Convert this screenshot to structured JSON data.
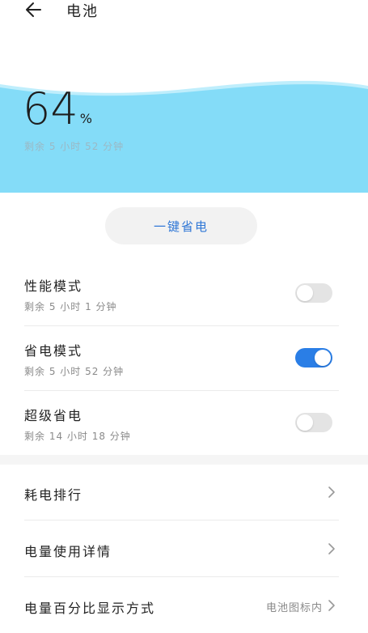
{
  "header": {
    "title": "电池"
  },
  "battery": {
    "percent": "64",
    "unit": "%",
    "remaining": "剩余 5 小时 52 分钟",
    "wave_color": "#84dcf8"
  },
  "one_key": {
    "label": "一键省电",
    "color": "#2f77d6"
  },
  "modes": [
    {
      "title": "性能模式",
      "subtitle": "剩余 5 小时 1 分钟",
      "enabled": false
    },
    {
      "title": "省电模式",
      "subtitle": "剩余 5 小时 52 分钟",
      "enabled": true
    },
    {
      "title": "超级省电",
      "subtitle": "剩余 14 小时 18 分钟",
      "enabled": false
    }
  ],
  "nav": [
    {
      "label": "耗电排行"
    },
    {
      "label": "电量使用详情"
    },
    {
      "label": "电量百分比显示方式",
      "value": "电池图标内"
    }
  ],
  "colors": {
    "toggle_on": "#2a7ee6",
    "toggle_off": "#e4e4e4"
  }
}
